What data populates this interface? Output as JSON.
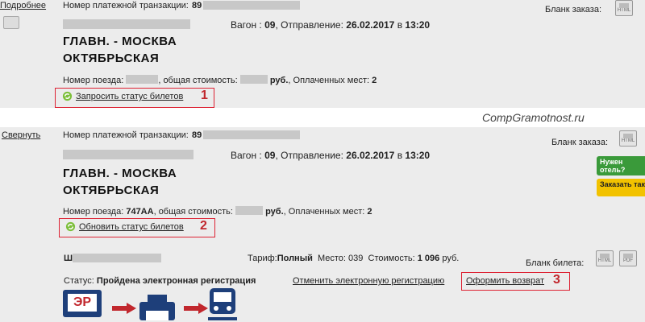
{
  "order1": {
    "details_link": "Подробнее",
    "transaction_label": "Номер платежной транзакции:",
    "transaction_value": "89",
    "blank_label": "Бланк заказа:",
    "wagon_label": "Вагон :",
    "wagon_value": "09",
    "departure_label": ", Отправление:",
    "departure_date": "26.02.2017",
    "departure_in": "в",
    "departure_time": "13:20",
    "route_line1": "ГЛАВН. - МОСКВА",
    "route_line2": "ОКТЯБРЬСКАЯ",
    "train_label": "Номер поезда:",
    "cost_label": ", общая стоимость:",
    "currency": "руб.",
    "paid_label": ", Оплаченных мест:",
    "paid_value": "2",
    "status_action": "Запросить статус билетов",
    "marker": "1"
  },
  "watermark": "CompGramotnost.ru",
  "order2": {
    "collapse_link": "Свернуть",
    "transaction_label": "Номер платежной транзакции:",
    "transaction_value": "89",
    "blank_label": "Бланк заказа:",
    "wagon_label": "Вагон :",
    "wagon_value": "09",
    "departure_label": ", Отправление:",
    "departure_date": "26.02.2017",
    "departure_in": "в",
    "departure_time": "13:20",
    "route_line1": "ГЛАВН. - МОСКВА",
    "route_line2": "ОКТЯБРЬСКАЯ",
    "train_label": "Номер поезда:",
    "train_value": "747АА",
    "cost_label": ", общая стоимость:",
    "currency": "руб.",
    "paid_label": ", Оплаченных мест:",
    "paid_value": "2",
    "status_action": "Обновить статус билетов",
    "marker": "2",
    "hotel_badge": "Нужен отель?",
    "taxi_badge": "Заказать такси"
  },
  "ticket": {
    "passenger_initial": "Ш",
    "tariff_label": "Тариф:",
    "tariff_value": "Полный",
    "seat_label": "Место:",
    "seat_value": "039",
    "cost_label": "Стоимость:",
    "cost_value": "1 096",
    "currency": "руб.",
    "blank_label": "Бланк билета:",
    "status_label": "Статус:",
    "status_value": "Пройдена электронная регистрация",
    "cancel_reg": "Отменить электронную регистрацию",
    "refund": "Оформить возврат",
    "marker": "3",
    "er_label": "ЭР"
  },
  "colors": {
    "marker": "#c1272d",
    "panel": "#ececec",
    "hotel": "#3a9a3a",
    "taxi": "#f2c200"
  }
}
